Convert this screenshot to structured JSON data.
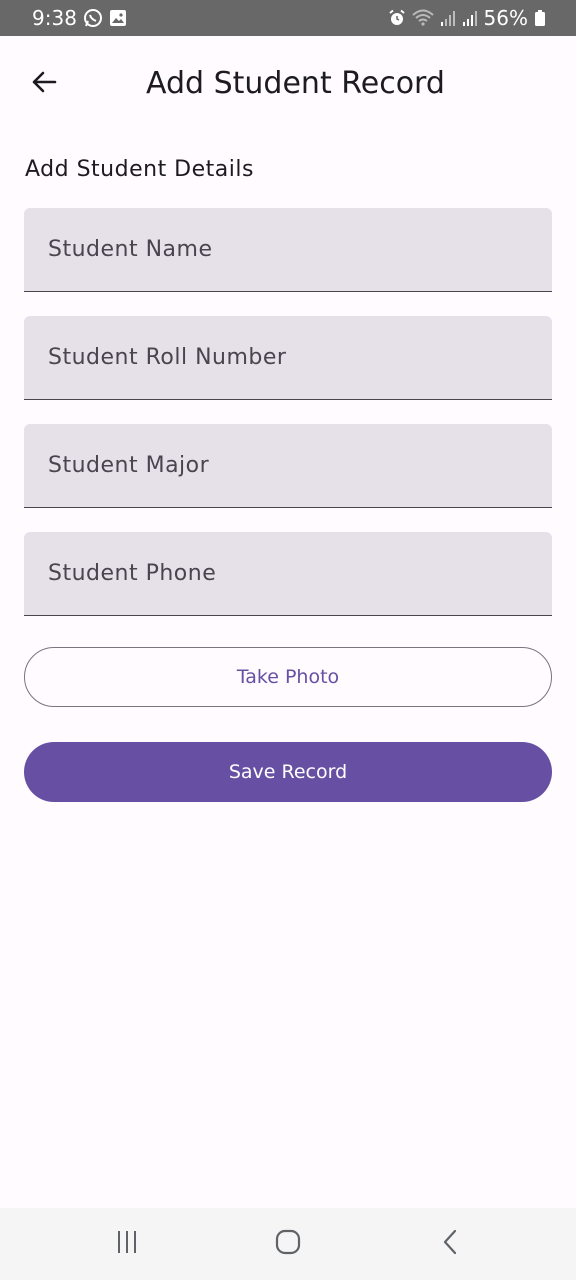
{
  "status_bar": {
    "time": "9:38",
    "battery": "56%",
    "icons": [
      "whatsapp-icon",
      "gallery-icon",
      "alarm-icon",
      "wifi-icon",
      "signal-icon",
      "signal-icon",
      "battery-icon"
    ]
  },
  "app_bar": {
    "title": "Add Student Record",
    "back_icon": "arrow-back-icon"
  },
  "form": {
    "section_label": "Add Student Details",
    "fields": [
      {
        "placeholder": "Student Name",
        "value": ""
      },
      {
        "placeholder": "Student Roll Number",
        "value": ""
      },
      {
        "placeholder": "Student Major",
        "value": ""
      },
      {
        "placeholder": "Student Phone",
        "value": ""
      }
    ],
    "take_photo_label": "Take Photo",
    "save_label": "Save Record"
  },
  "nav_bar": {
    "icons": [
      "recent-apps-icon",
      "home-icon",
      "back-nav-icon"
    ]
  },
  "colors": {
    "primary": "#6750a4",
    "field_bg": "#e6e0e9",
    "background": "#fffbfe",
    "status_bar": "#686868"
  }
}
